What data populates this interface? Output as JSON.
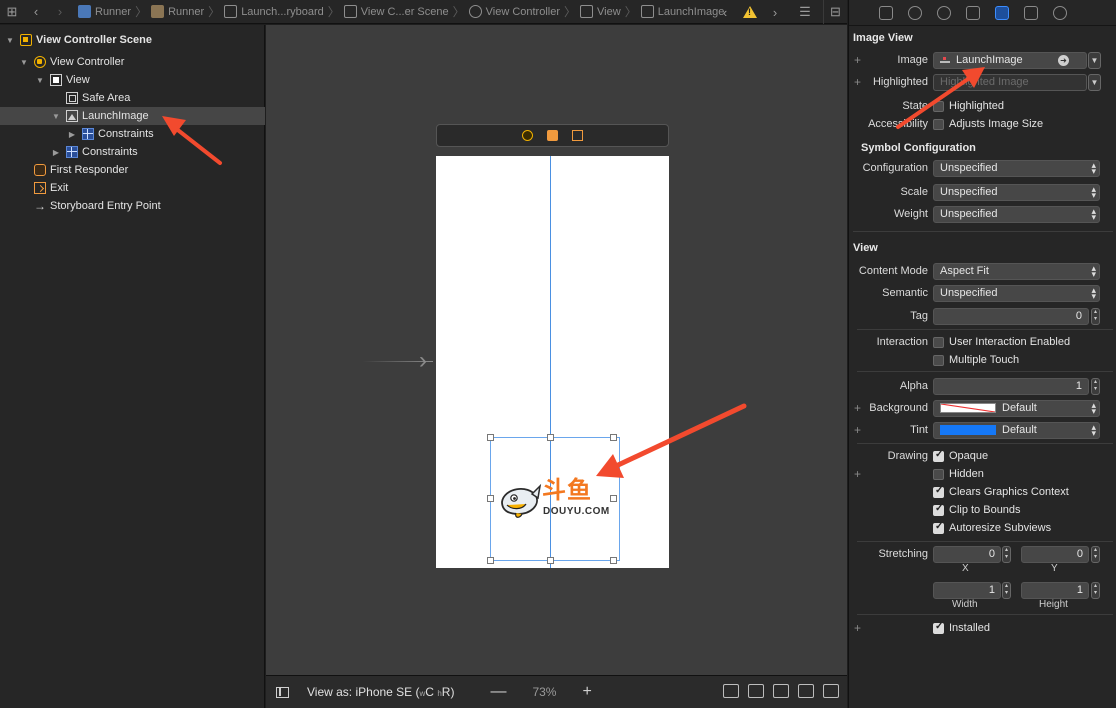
{
  "breadcrumb": [
    {
      "label": "Runner",
      "icon": "file-icon"
    },
    {
      "label": "Runner",
      "icon": "folder-icon"
    },
    {
      "label": "Launch...ryboard",
      "icon": "storyboard-icon"
    },
    {
      "label": "View C...er Scene",
      "icon": "scene-icon"
    },
    {
      "label": "View Controller",
      "icon": "view-controller-icon"
    },
    {
      "label": "View",
      "icon": "view-icon"
    },
    {
      "label": "LaunchImage",
      "icon": "image-icon"
    }
  ],
  "outline": {
    "items": [
      {
        "label": "View Controller Scene",
        "icon": "scene-icon"
      },
      {
        "label": "View Controller",
        "icon": "view-controller-icon"
      },
      {
        "label": "View",
        "icon": "view-icon"
      },
      {
        "label": "Safe Area",
        "icon": "safe-area-icon"
      },
      {
        "label": "LaunchImage",
        "icon": "image-icon"
      },
      {
        "label": "Constraints",
        "icon": "constraints-icon"
      },
      {
        "label": "Constraints",
        "icon": "constraints-icon"
      },
      {
        "label": "First Responder",
        "icon": "first-responder-icon"
      },
      {
        "label": "Exit",
        "icon": "exit-icon"
      },
      {
        "label": "Storyboard Entry Point",
        "icon": "arrow-right-icon"
      }
    ]
  },
  "canvas": {
    "logo_cn": "斗鱼",
    "logo_en": "DOUYU.COM"
  },
  "canvasbar": {
    "view_as_prefix": "View as: iPhone SE (",
    "w_size": "w",
    "c": "C",
    "h_size": "h",
    "r": "R",
    "view_as_suffix": ")",
    "zoom": "73%",
    "minus": "—",
    "plus": "+"
  },
  "inspector": {
    "image_view": {
      "title": "Image View",
      "image_label": "Image",
      "image_value": "LaunchImage",
      "highlighted_label": "Highlighted",
      "highlighted_placeholder": "Highlighted Image",
      "state_label": "State",
      "state_option": "Highlighted",
      "accessibility_label": "Accessibility",
      "accessibility_option": "Adjusts Image Size"
    },
    "symbol": {
      "title": "Symbol Configuration",
      "configuration_label": "Configuration",
      "configuration_value": "Unspecified",
      "scale_label": "Scale",
      "scale_value": "Unspecified",
      "weight_label": "Weight",
      "weight_value": "Unspecified"
    },
    "view": {
      "title": "View",
      "content_mode_label": "Content Mode",
      "content_mode_value": "Aspect Fit",
      "semantic_label": "Semantic",
      "semantic_value": "Unspecified",
      "tag_label": "Tag",
      "tag_value": "0",
      "interaction_label": "Interaction",
      "user_interaction": "User Interaction Enabled",
      "multiple_touch": "Multiple Touch",
      "alpha_label": "Alpha",
      "alpha_value": "1",
      "background_label": "Background",
      "background_value": "Default",
      "tint_label": "Tint",
      "tint_value": "Default",
      "drawing_label": "Drawing",
      "opaque": "Opaque",
      "hidden": "Hidden",
      "clears_graphics": "Clears Graphics Context",
      "clip_to_bounds": "Clip to Bounds",
      "autoresize": "Autoresize Subviews",
      "stretching_label": "Stretching",
      "stretch_x": "0",
      "stretch_y": "0",
      "x_label": "X",
      "y_label": "Y",
      "stretch_w": "1",
      "stretch_h": "1",
      "width_label": "Width",
      "height_label": "Height",
      "installed": "Installed"
    }
  },
  "colors": {
    "annotation_arrow": "#f24a2e",
    "selection": "#4a90e2",
    "scene_icon": "#f1b100",
    "responder_icon": "#f09a3e",
    "logo_orange": "#f37820"
  }
}
